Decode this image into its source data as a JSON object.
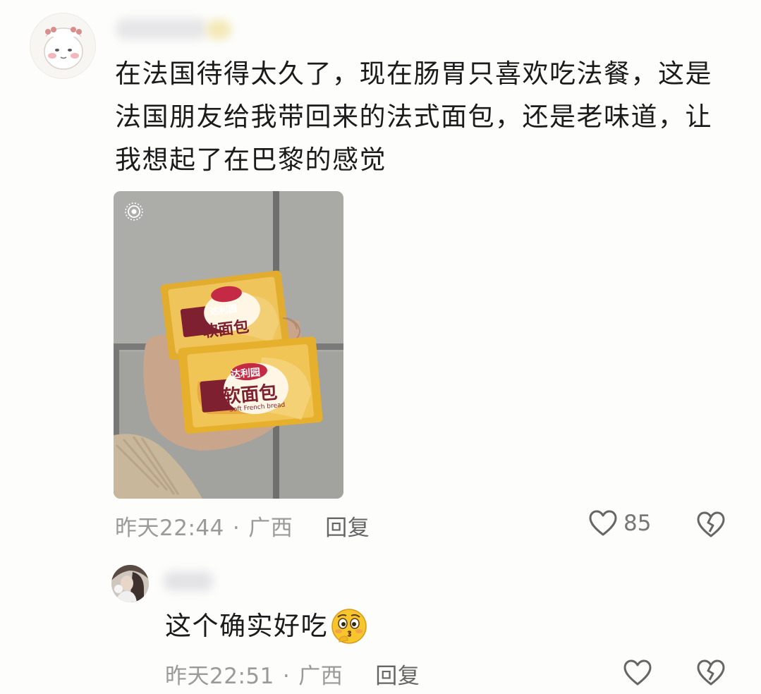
{
  "comment": {
    "text": "在法国待得太久了，现在肠胃只喜欢吃法餐，这是法国朋友给我带回来的法式面包，还是老味道，让我想起了在巴黎的感觉",
    "photo": {
      "brand_text": "达利园",
      "product_text": "软面包",
      "sub_text": "Soft French bread",
      "live_icon": "live-photo-icon"
    },
    "time": "昨天22:44",
    "separator": "·",
    "location": "广西",
    "reply_label": "回复",
    "like_count": "85",
    "icons": [
      "heart-icon",
      "broken-heart-icon"
    ]
  },
  "reply": {
    "text": "这个确实好吃",
    "emoji": "thinking-kiss-emoji",
    "time": "昨天22:51",
    "separator": "·",
    "location": "广西",
    "reply_label": "回复",
    "icons": [
      "heart-icon",
      "broken-heart-icon"
    ]
  },
  "colors": {
    "background": "#fdfdfb",
    "text": "#1b1b1b",
    "meta": "#9a9a9a",
    "package": "#e8b53a"
  }
}
